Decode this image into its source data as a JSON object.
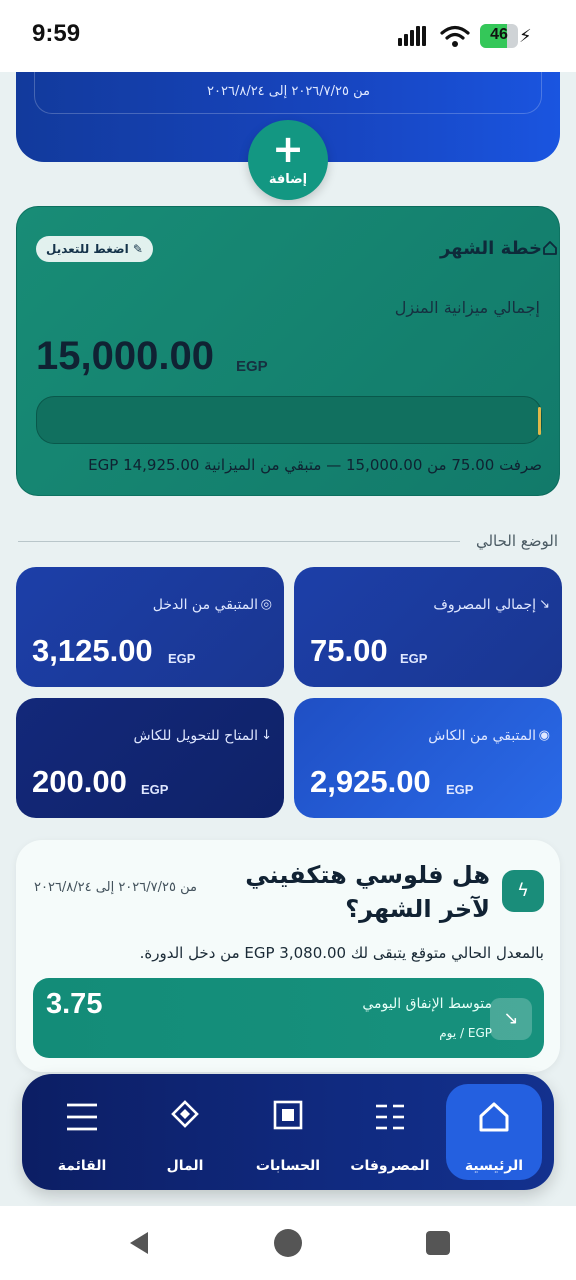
{
  "status_bar": {
    "time": "9:59",
    "battery": "46"
  },
  "top_card": {
    "range": "من ٢٠٢٦/٧/٢٥ إلى ٢٠٢٦/٨/٢٤"
  },
  "add_button": {
    "label": "إضافة"
  },
  "plan": {
    "title": "خطة الشهر",
    "edit_label": "✎ اضغط للتعديل",
    "subtitle": "إجمالي ميزانية المنزل",
    "amount": "15,000.00",
    "currency": "EGP",
    "spent_fraction": 0.005,
    "note": "صرفت 75.00 من 15,000.00 — متبقي من الميزانية 14,925.00 EGP"
  },
  "current_status": {
    "title": "الوضع الحالي"
  },
  "stats": [
    {
      "label": "إجمالي المصروف",
      "icon": "↘",
      "value": "75.00",
      "currency": "EGP"
    },
    {
      "label": "المتبقي من الدخل",
      "icon": "◎",
      "value": "3,125.00",
      "currency": "EGP"
    },
    {
      "label": "المتبقي من الكاش",
      "icon": "◉",
      "value": "2,925.00",
      "currency": "EGP"
    },
    {
      "label": "المتاح للتحويل للكاش",
      "icon": "↓",
      "value": "200.00",
      "currency": "EGP"
    }
  ],
  "forecast": {
    "title": "هل فلوسي هتكفيني لآخر الشهر؟",
    "range": "من ٢٠٢٦/٧/٢٥ إلى ٢٠٢٦/٨/٢٤",
    "note": "بالمعدل الحالي متوقع يتبقى لك EGP 3,080.00 من دخل الدورة.",
    "daily_label": "متوسط الإنفاق اليومي",
    "daily_unit": "EGP / يوم",
    "daily_value": "3.75"
  },
  "nav": {
    "items": [
      {
        "label": "الرئيسية",
        "icon": "home-icon",
        "active": true
      },
      {
        "label": "المصروفات",
        "icon": "list-icon",
        "active": false
      },
      {
        "label": "الحسابات",
        "icon": "accounts-icon",
        "active": false
      },
      {
        "label": "المال",
        "icon": "diamond-icon",
        "active": false
      },
      {
        "label": "القائمة",
        "icon": "menu-icon",
        "active": false
      }
    ]
  },
  "colors": {
    "primary_blue": "#1745c0",
    "teal": "#139782",
    "active_nav": "#2460e0"
  }
}
